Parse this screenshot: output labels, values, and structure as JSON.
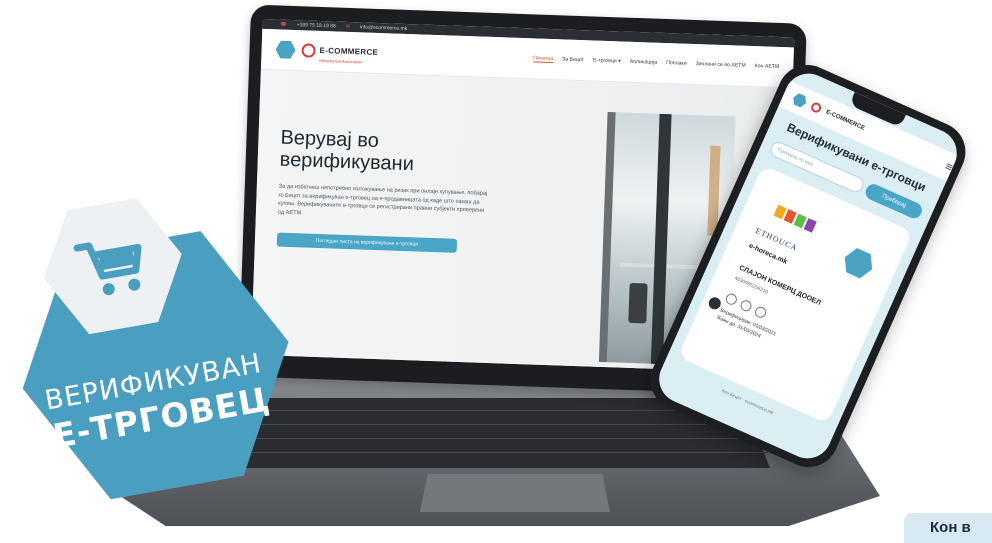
{
  "laptop": {
    "topstrip": {
      "phone": "+389 75 18 19 88",
      "email": "info@ecommerce.mk"
    },
    "logo": {
      "brand": "E-COMMERCE",
      "tagline": "Macedonian Association"
    },
    "nav": [
      "Почетна",
      "За Бецот",
      "Е-трговци",
      "Апликација",
      "Поплаки",
      "Зачлени се во АЕТМ",
      "Кон АЕТМ"
    ],
    "nav_active": "Почетна",
    "nav_dropdown_icon": "chevron-down-icon",
    "hero": {
      "title": "Верувај во верификувани",
      "text": "За да избегнеш непотребно изложување на ризик при онлајн купување, побарај го Бецот за верификуван е-трговец на е-продавницата од каде што сакаш да купиш. Верификуваните е-трговци се регистрирани правни субјекти проверени од АЕТМ.",
      "button": "Погледни листа на верификувани е-трговци"
    }
  },
  "badge": {
    "line1": "ВЕРИФИКУВАН",
    "line2": "Е-ТРГОВЕЦ",
    "icon": "shopping-cart-icon",
    "color": "#4a9fc1"
  },
  "phone": {
    "header_logo": "E-COMMERCE",
    "menu_icon": "hamburger-icon",
    "title": "Верификувани е-трговци",
    "search_placeholder": "Пребарај по име",
    "search_button": "Пребарај",
    "card": {
      "brand_name": "ETHOUCA",
      "domain": "e-horeca.mk",
      "company": "СЛАЈОН КОМЕРЦ ДООЕЛ",
      "reg_number": "4030995256210",
      "verified_label": "Верифициран: 01/03/2021",
      "valid_label": "Важи до: 31/03/2024"
    },
    "footer": "Кон Бецот · ecommerce.mk"
  },
  "corner_tab": {
    "label": "Кон в"
  }
}
